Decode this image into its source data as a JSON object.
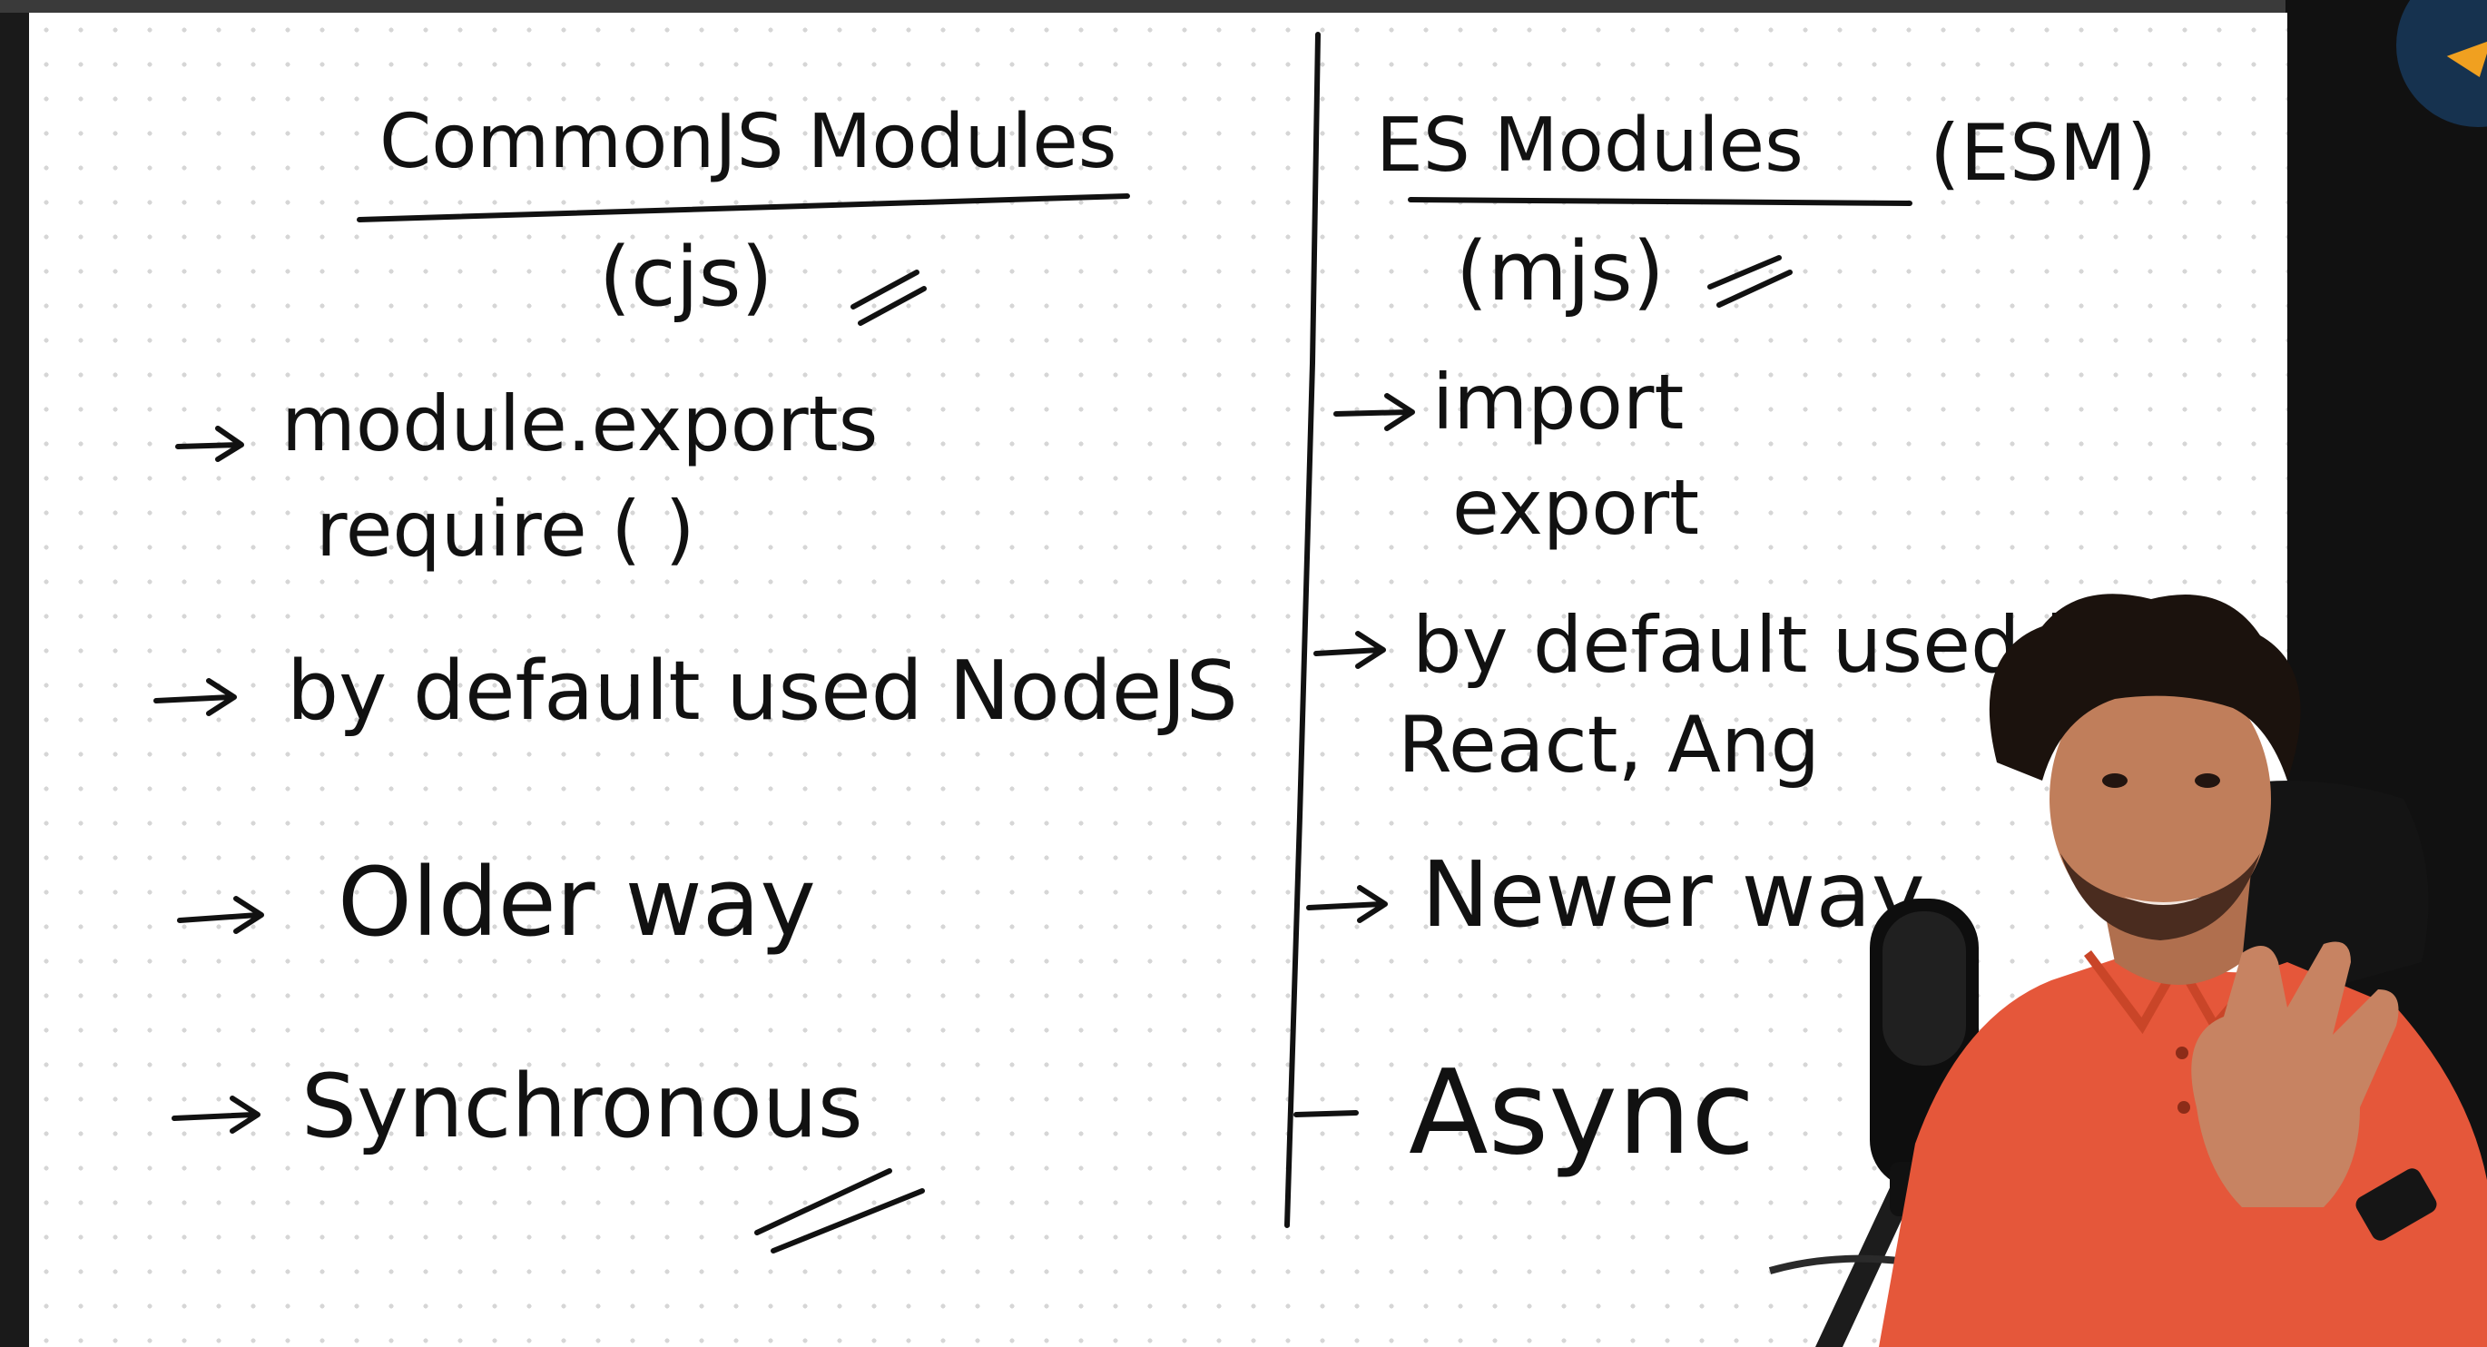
{
  "whiteboard": {
    "left_column": {
      "title": "CommonJS Modules",
      "subtitle": "(cjs)",
      "points": [
        {
          "line1": "module.exports",
          "line2": "require ( )"
        },
        {
          "line1": "by default used NodeJS"
        },
        {
          "line1": "Older way"
        },
        {
          "line1": "Synchronous"
        }
      ]
    },
    "right_column": {
      "title": "ES Modules",
      "title_suffix": "(ESM)",
      "subtitle": "(mjs)",
      "points": [
        {
          "line1": "import",
          "line2": "export"
        },
        {
          "line1": "by default used in",
          "line2": "React, Ang"
        },
        {
          "line1": "Newer way"
        },
        {
          "line1": "Async"
        }
      ]
    }
  },
  "colors": {
    "ink": "#111111",
    "board": "#ffffff",
    "shirt": "#e5573a",
    "background": "#1a1a1a"
  }
}
